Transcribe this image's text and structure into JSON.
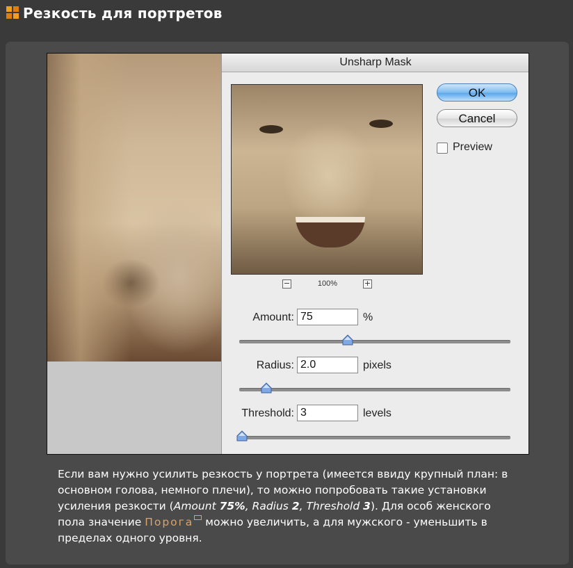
{
  "header": {
    "title": "Резкость для портретов",
    "icon": "orange-grid-icon"
  },
  "dialog": {
    "title": "Unsharp Mask",
    "ok_label": "OK",
    "cancel_label": "Cancel",
    "preview_label": "Preview",
    "preview_checked": false,
    "zoom": "100%",
    "zoom_out_label": "−",
    "zoom_in_label": "+",
    "amount": {
      "label": "Amount:",
      "value": "75",
      "unit": "%",
      "slider_fraction": 0.4
    },
    "radius": {
      "label": "Radius:",
      "value": "2.0",
      "unit": "pixels",
      "slider_fraction": 0.1
    },
    "threshold": {
      "label": "Threshold:",
      "value": "3",
      "unit": "levels",
      "slider_fraction": 0.01
    }
  },
  "caption": {
    "part1": "Если вам нужно усилить резкость у портрета (имеется ввиду крупный план: в основном голова, немного плечи), то можно попробовать такие установки усиления резкости (",
    "amount_name": "Amount",
    "amount_value": "75%",
    "sep1": ", ",
    "radius_name": "Radius",
    "radius_value": "2",
    "sep2": ", ",
    "threshold_name": "Threshold",
    "threshold_value": "3",
    "part2": "). Для особ женского пола значение ",
    "link": "Порога",
    "part3": " можно увеличить, а для мужского - уменьшить в пределах одного уровня."
  },
  "colors": {
    "accent": "#f0a020",
    "link": "#d9a36a"
  }
}
